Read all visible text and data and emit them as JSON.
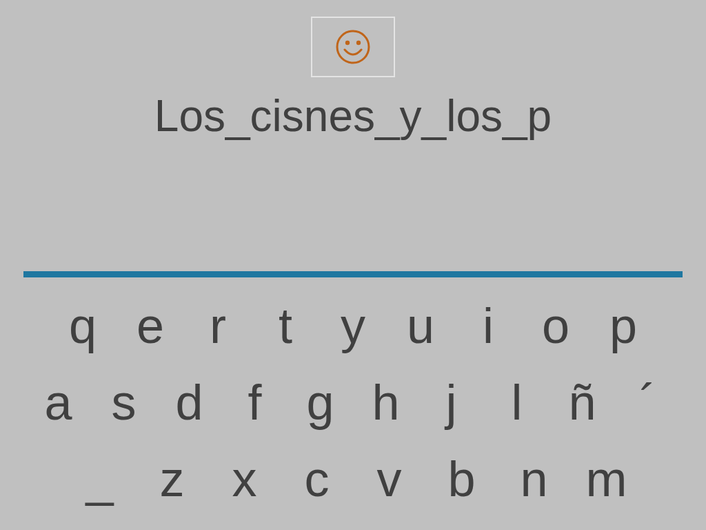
{
  "answer": {
    "text": "Los_cisnes_y_los_p"
  },
  "keyboard": {
    "rows": [
      [
        "q",
        "e",
        "r",
        "t",
        "y",
        "u",
        "i",
        "o",
        "p"
      ],
      [
        "a",
        "s",
        "d",
        "f",
        "g",
        "h",
        "j",
        "l",
        "ñ",
        "´"
      ],
      [
        "_",
        "z",
        "x",
        "c",
        "v",
        "b",
        "n",
        "m"
      ]
    ]
  }
}
